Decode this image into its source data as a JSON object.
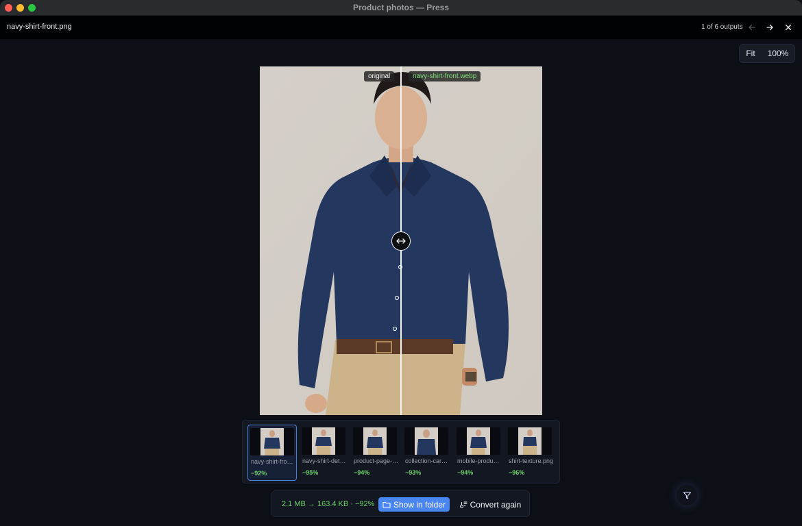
{
  "window": {
    "title": "Product photos — Press"
  },
  "header": {
    "filename": "navy-shirt-front.png",
    "counter": "1 of 6 outputs"
  },
  "zoom": {
    "fit_label": "Fit",
    "level_label": "100%"
  },
  "compare": {
    "left_label": "original",
    "right_label": "navy-shirt-front.webp",
    "split_fraction": 0.5
  },
  "thumbnails": [
    {
      "name": "navy-shirt-front.png",
      "savings": "−92%",
      "active": true
    },
    {
      "name": "navy-shirt-detail.png",
      "savings": "−95%",
      "active": false
    },
    {
      "name": "product-page-hero.png",
      "savings": "−94%",
      "active": false
    },
    {
      "name": "collection-card.png",
      "savings": "−93%",
      "active": false
    },
    {
      "name": "mobile-product.png",
      "savings": "−94%",
      "active": false
    },
    {
      "name": "shirt-texture.png",
      "savings": "−96%",
      "active": false
    }
  ],
  "footer": {
    "size_info": "2.1 MB → 163.4 KB · −92%",
    "show_folder_label": "Show in folder",
    "convert_again_label": "Convert again"
  },
  "colors": {
    "accent": "#4a86f0",
    "savings_green": "#6fd36a",
    "background": "#0c0f15"
  },
  "icons": {
    "prev": "arrow-left-icon",
    "next": "arrow-right-icon",
    "close": "close-icon",
    "handle": "horizontal-arrows-icon",
    "folder": "folder-icon",
    "convert": "convert-icon",
    "filter": "filter-icon"
  }
}
